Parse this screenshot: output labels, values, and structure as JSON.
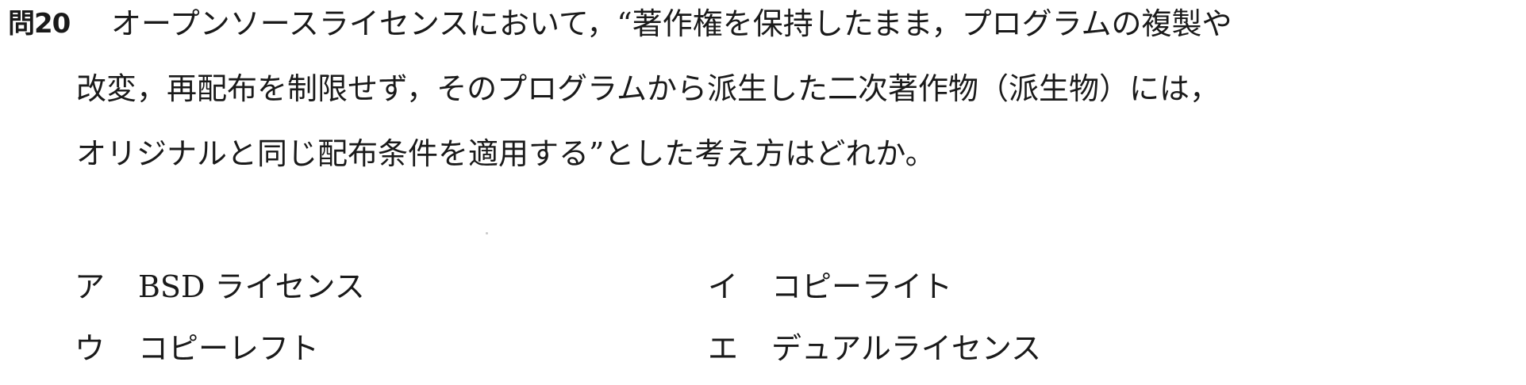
{
  "question": {
    "number": "問20",
    "lines": [
      "オープンソースライセンスにおいて，“著作権を保持したまま，プログラムの複製や",
      "改変，再配布を制限せず，そのプログラムから派生した二次著作物（派生物）には，",
      "オリジナルと同じ配布条件を適用する”とした考え方はどれか。"
    ]
  },
  "choices": [
    {
      "mark": "ア",
      "text": "BSD ライセンス"
    },
    {
      "mark": "イ",
      "text": "コピーライト"
    },
    {
      "mark": "ウ",
      "text": "コピーレフト"
    },
    {
      "mark": "エ",
      "text": "デュアルライセンス"
    }
  ]
}
